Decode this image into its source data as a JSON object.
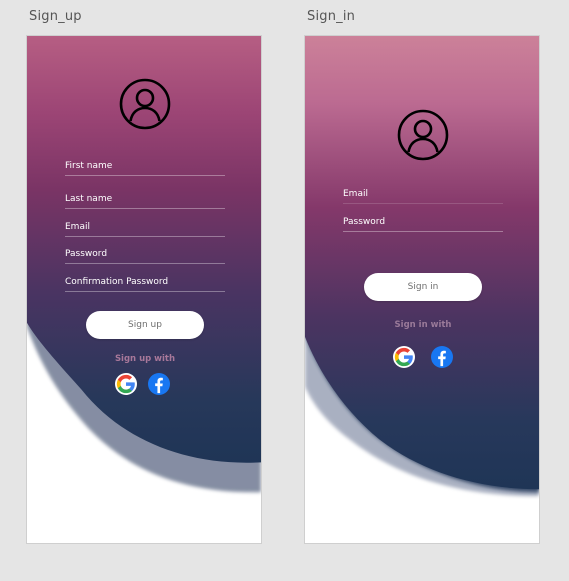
{
  "artboards": {
    "signup_title": "Sign_up",
    "signin_title": "Sign_in"
  },
  "signup": {
    "fields": [
      "First name",
      "Last name",
      "Email",
      "Password",
      "Confirmation Password"
    ],
    "button_label": "Sign up",
    "social_text": "Sign up with"
  },
  "signin": {
    "fields": [
      "Email",
      "Password"
    ],
    "button_label": "Sign in",
    "social_text": "Sign in with"
  },
  "icons": {
    "avatar": "user-avatar-icon",
    "google": "google-icon",
    "facebook": "facebook-icon"
  },
  "colors": {
    "gradient_top": "#b0597f",
    "gradient_mid": "#6a2f5d",
    "gradient_bottom": "#263759",
    "canvas": "#e5e5e5",
    "social_text_signup": "#a8789a",
    "social_text_signin": "#9a7a99",
    "facebook": "#1877f2"
  }
}
